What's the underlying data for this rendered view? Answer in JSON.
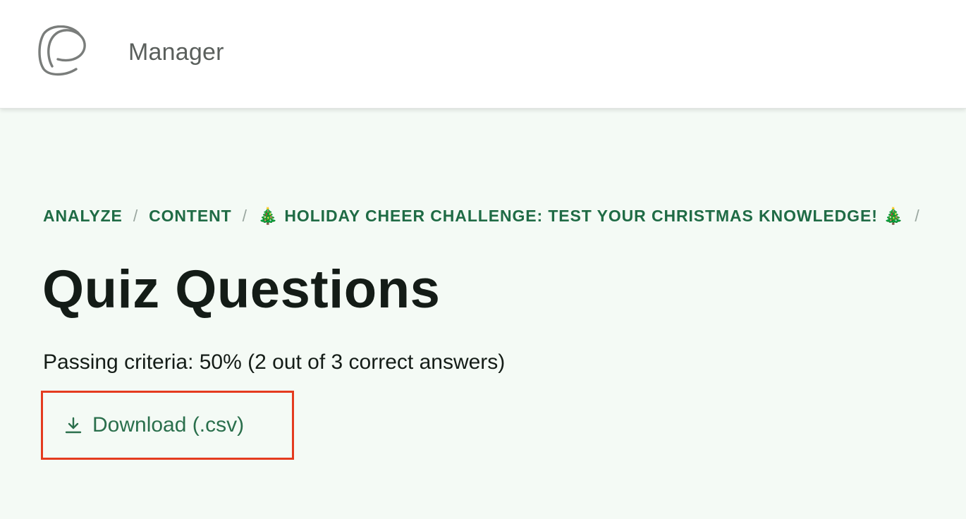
{
  "header": {
    "app_name": "Manager",
    "logo_icon": "app-logo-icon"
  },
  "breadcrumb": {
    "items": [
      {
        "label": "ANALYZE"
      },
      {
        "label": "CONTENT"
      },
      {
        "label": "HOLIDAY CHEER CHALLENGE: TEST YOUR CHRISTMAS KNOWLEDGE!",
        "leading_emoji": "🎄",
        "trailing_emoji": "🎄"
      }
    ],
    "separator": "/"
  },
  "page": {
    "title": "Quiz Questions",
    "passing_criteria": "Passing criteria: 50% (2 out of 3 correct answers)"
  },
  "download": {
    "label": "Download (.csv)",
    "icon": "download-icon"
  },
  "colors": {
    "background": "#f4faf5",
    "accent_green": "#1f6b45",
    "highlight_border": "#e43b1f"
  }
}
